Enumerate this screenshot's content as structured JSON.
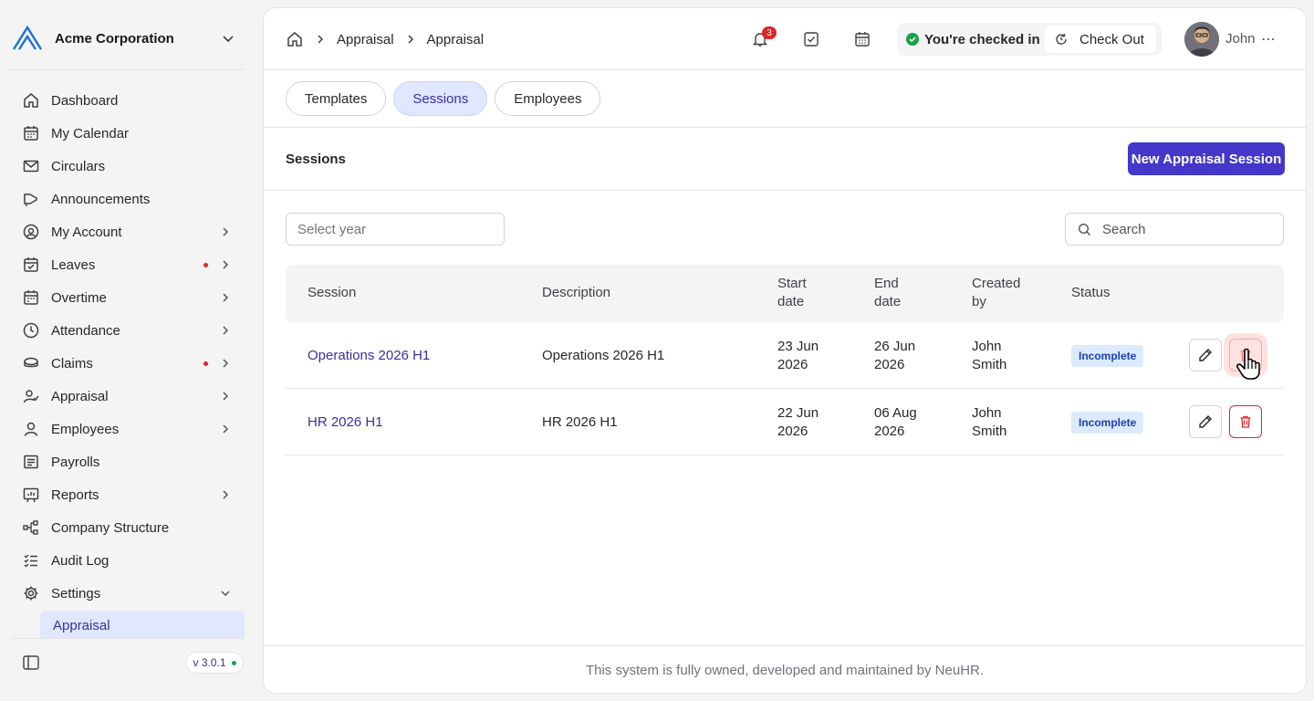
{
  "org": {
    "name": "Acme Corporation"
  },
  "sidebar": {
    "items": [
      {
        "label": "Dashboard",
        "icon": "home-icon"
      },
      {
        "label": "My Calendar",
        "icon": "calendar-icon"
      },
      {
        "label": "Circulars",
        "icon": "mail-icon"
      },
      {
        "label": "Announcements",
        "icon": "megaphone-icon"
      },
      {
        "label": "My Account",
        "icon": "user-circle-icon",
        "has_arrow": true
      },
      {
        "label": "Leaves",
        "icon": "calendar-check-icon",
        "has_arrow": true,
        "dot": true
      },
      {
        "label": "Overtime",
        "icon": "calendar-icon",
        "has_arrow": true
      },
      {
        "label": "Attendance",
        "icon": "clock-icon",
        "has_arrow": true
      },
      {
        "label": "Claims",
        "icon": "coins-icon",
        "has_arrow": true,
        "dot": true
      },
      {
        "label": "Appraisal",
        "icon": "user-check-icon",
        "has_arrow": true
      },
      {
        "label": "Employees",
        "icon": "user-icon",
        "has_arrow": true
      },
      {
        "label": "Payrolls",
        "icon": "receipt-icon"
      },
      {
        "label": "Reports",
        "icon": "chart-icon",
        "has_arrow": true
      },
      {
        "label": "Company Structure",
        "icon": "hierarchy-icon"
      },
      {
        "label": "Audit Log",
        "icon": "list-check-icon"
      },
      {
        "label": "Settings",
        "icon": "gear-icon",
        "expanded": true
      }
    ],
    "sub_item": "Appraisal",
    "version": "v 3.0.1"
  },
  "breadcrumb": [
    "Appraisal",
    "Appraisal"
  ],
  "notifications": {
    "count": "3"
  },
  "checkin": {
    "status": "You're checked in",
    "button": "Check Out"
  },
  "user": {
    "name": "John"
  },
  "tabs": [
    {
      "label": "Templates",
      "active": false
    },
    {
      "label": "Sessions",
      "active": true
    },
    {
      "label": "Employees",
      "active": false
    }
  ],
  "section": {
    "title": "Sessions",
    "new_button": "New Appraisal Session"
  },
  "filters": {
    "year_placeholder": "Select year",
    "search_placeholder": "Search"
  },
  "table": {
    "headers": {
      "session": "Session",
      "description": "Description",
      "start": [
        "Start",
        "date"
      ],
      "end": [
        "End",
        "date"
      ],
      "created": [
        "Created",
        "by"
      ],
      "status": "Status"
    },
    "rows": [
      {
        "session": "Operations 2026 H1",
        "description": "Operations 2026 H1",
        "start": [
          "23 Jun",
          "2026"
        ],
        "end": [
          "26 Jun",
          "2026"
        ],
        "created": [
          "John",
          "Smith"
        ],
        "status": "Incomplete"
      },
      {
        "session": "HR 2026 H1",
        "description": "HR 2026 H1",
        "start": [
          "22 Jun",
          "2026"
        ],
        "end": [
          "06 Aug",
          "2026"
        ],
        "created": [
          "John",
          "Smith"
        ],
        "status": "Incomplete"
      }
    ]
  },
  "footer": {
    "text": "This system is fully owned, developed and maintained by NeuHR."
  },
  "colors": {
    "accent": "#4338ca",
    "danger": "#dc2626",
    "success": "#16a34a"
  }
}
